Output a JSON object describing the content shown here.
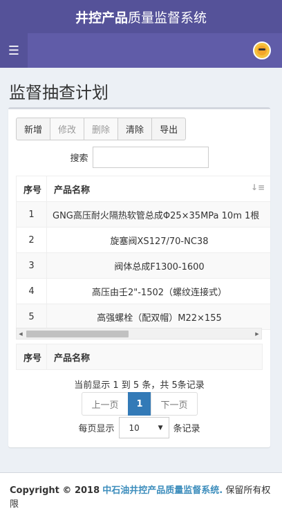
{
  "app": {
    "brand_bold": "井控产品",
    "brand_rest": "质量监督系统"
  },
  "page": {
    "title": "监督抽查计划"
  },
  "toolbar": {
    "add": "新增",
    "edit": "修改",
    "delete": "删除",
    "clear": "清除",
    "export": "导出"
  },
  "search": {
    "label": "搜索",
    "value": ""
  },
  "table": {
    "headers": {
      "index": "序号",
      "name": "产品名称"
    },
    "rows": [
      {
        "index": "1",
        "name": "GNG高压耐火隔热软管总成Φ25×35MPa 10m 1根"
      },
      {
        "index": "2",
        "name": "旋塞阀XS127/70-NC38"
      },
      {
        "index": "3",
        "name": "阀体总成F1300-1600"
      },
      {
        "index": "4",
        "name": "高压由壬2\"-1502（螺纹连接式）"
      },
      {
        "index": "5",
        "name": "高强螺栓（配双帽）M22×155"
      }
    ]
  },
  "pagination": {
    "summary": "当前显示 1 到 5 条，共 5条记录",
    "prev": "上一页",
    "current": "1",
    "next": "下一页",
    "per_page_prefix": "每页显示",
    "per_page_value": "10",
    "per_page_suffix": "条记录"
  },
  "footer": {
    "copyright": "Copyright © 2018",
    "org": "中石油井控产品质量监督系统.",
    "rights": "保留所有权限"
  }
}
